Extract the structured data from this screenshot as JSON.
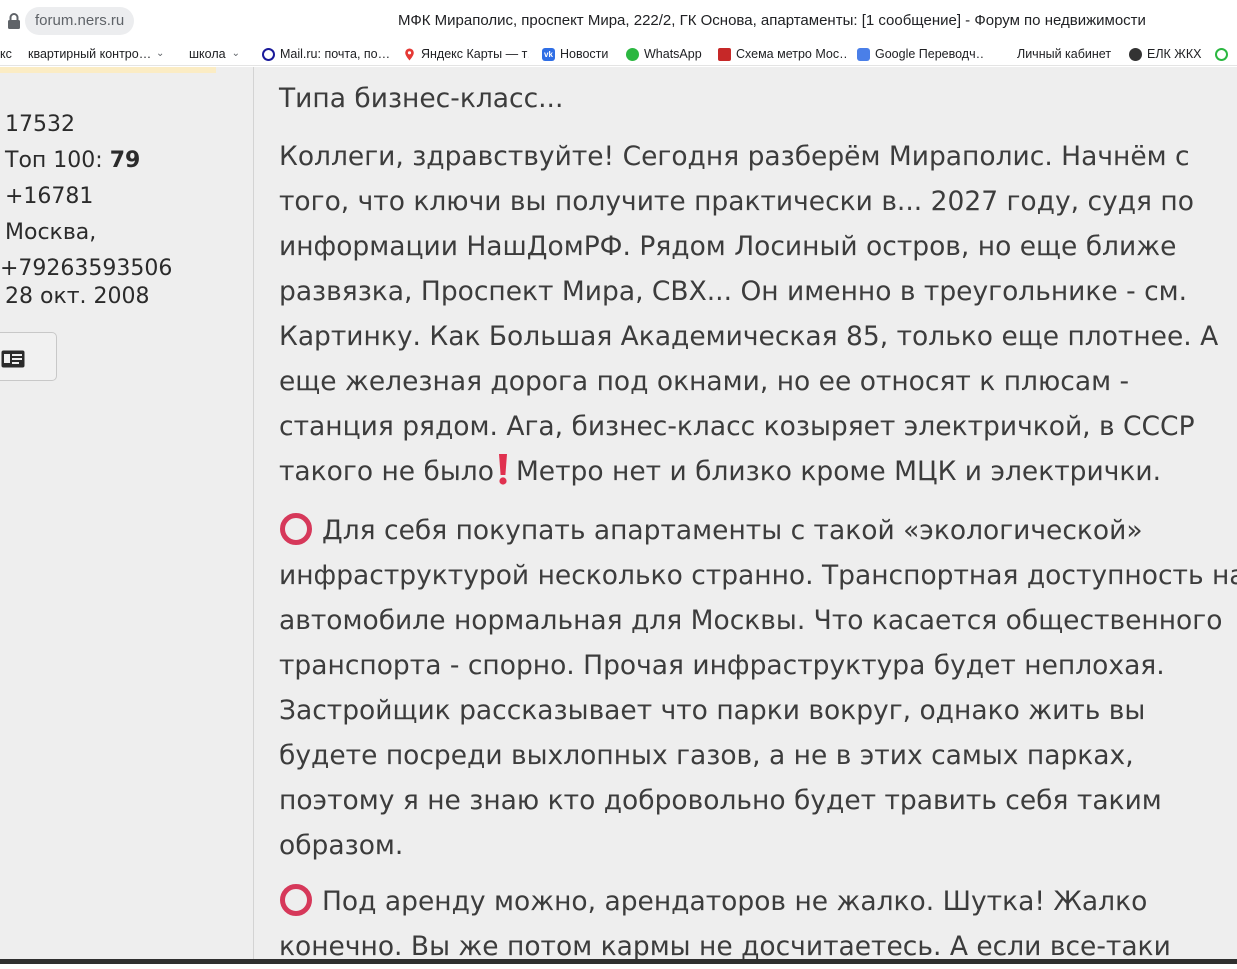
{
  "browser": {
    "url": "forum.ners.ru",
    "title": "МФК Мираполис, проспект Мира, 222/2, ГК Основа, апартаменты: [1 сообщение] - Форум по недвижимости",
    "bookmarks": [
      {
        "label": "кс",
        "icon": "none"
      },
      {
        "label": "квартирный контро…",
        "icon": "folder-dropdown"
      },
      {
        "label": "школа",
        "icon": "folder-dropdown"
      },
      {
        "label": "Mail.ru: почта, по…",
        "icon": "mailru-icon"
      },
      {
        "label": "Яндекс Карты — т…",
        "icon": "map-pin-icon"
      },
      {
        "label": "Новости",
        "icon": "vk-icon"
      },
      {
        "label": "WhatsApp",
        "icon": "whatsapp-icon"
      },
      {
        "label": "Схема метро Мос…",
        "icon": "metro-icon"
      },
      {
        "label": "Google Переводч…",
        "icon": "google-translate-icon"
      },
      {
        "label": "Личный кабинет",
        "icon": "none"
      },
      {
        "label": "ЕЛК ЖКХ",
        "icon": "elk-icon"
      }
    ]
  },
  "colors": {
    "page_bg": "#eeeeee",
    "text": "#3c3c3c",
    "ring_emoji": "#d6385a",
    "exclaim_emoji": "#e0314f",
    "progress_strip": "#fbecc4"
  },
  "sidebar": {
    "posts": "17532",
    "top100_label": "Топ 100:",
    "top100_value": "79",
    "rating": "+16781",
    "city": "Москва,",
    "phone": "+79263593506",
    "registered": "28 окт. 2008",
    "profile_button_icon": "id-card-icon"
  },
  "post": {
    "subject": "Типа бизнес-класс...",
    "paragraph1": [
      "Коллеги, здравствуйте! Сегодня разберём Мираполис. Начнём с",
      "того, что ключи вы получите практически в... 2027 году, судя по",
      "информации НашДомРФ. Рядом Лосиный остров, но еще ближе",
      "развязка, Проспект Мира, СВХ... Он именно в треугольнике - см.",
      "Картинку. Как Большая Академическая 85, только еще плотнее. А",
      "еще железная дорога под окнами, но ее относят к плюсам -",
      "станция рядом. Ага, бизнес-класс козыряет электричкой, в СССР"
    ],
    "paragraph1_last_before": "такого не было",
    "paragraph1_last_after": "Метро нет и близко кроме МЦК и электрички.",
    "paragraph2": [
      "Для себя покупать апартаменты с такой «экологической»",
      "инфраструктурой несколько странно. Транспортная доступность на",
      "автомобиле нормальная для Москвы. Что касается общественного",
      "транспорта - спорно. Прочая инфраструктура будет неплохая.",
      "Застройщик рассказывает что парки вокруг, однако жить вы",
      "будете посреди выхлопных газов, а не в этих самых парках,",
      "поэтому я не знаю кто добровольно будет травить себя таким",
      "образом."
    ],
    "paragraph3": [
      "Под аренду можно, арендаторов не жалко. Шутка! Жалко",
      "конечно. Вы же потом кармы не досчитаетесь. А если все-таки"
    ]
  }
}
